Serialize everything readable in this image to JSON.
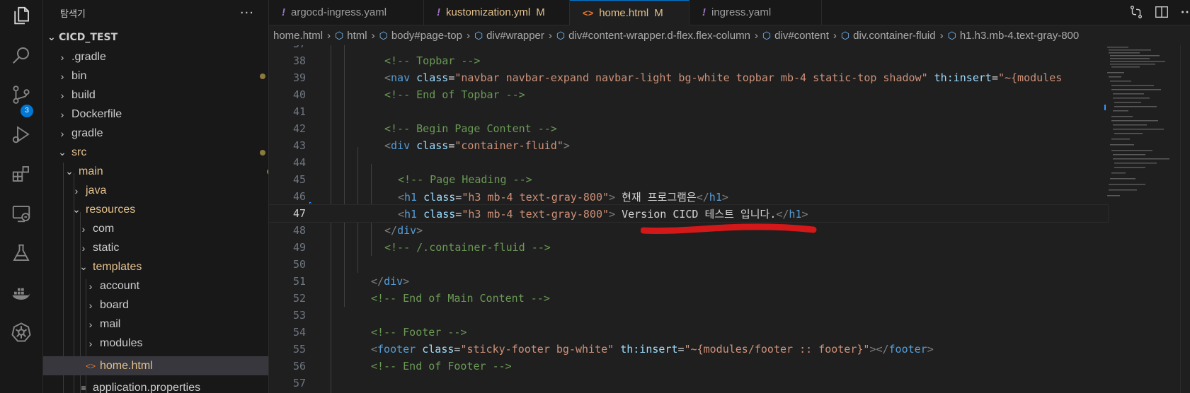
{
  "sidebar": {
    "title": "탐색기",
    "more": "···",
    "project": "CICD_TEST",
    "items": [
      {
        "label": ".gradle",
        "color": "#cccccc"
      },
      {
        "label": "bin",
        "color": "#cccccc"
      },
      {
        "label": "build",
        "color": "#cccccc"
      },
      {
        "label": "Dockerfile",
        "color": "#cccccc"
      },
      {
        "label": "gradle",
        "color": "#cccccc"
      },
      {
        "label": "src",
        "color": "#e2c08d"
      },
      {
        "label": "main",
        "color": "#e2c08d"
      },
      {
        "label": "java",
        "color": "#e2c08d"
      },
      {
        "label": "resources",
        "color": "#e2c08d"
      },
      {
        "label": "com",
        "color": "#cccccc"
      },
      {
        "label": "static",
        "color": "#cccccc"
      },
      {
        "label": "templates",
        "color": "#e2c08d"
      },
      {
        "label": "account",
        "color": "#cccccc"
      },
      {
        "label": "board",
        "color": "#cccccc"
      },
      {
        "label": "mail",
        "color": "#cccccc"
      },
      {
        "label": "modules",
        "color": "#cccccc"
      },
      {
        "label": "home.html",
        "color": "#e2c08d",
        "git": "M"
      },
      {
        "label": "application.properties",
        "color": "#cccccc"
      }
    ]
  },
  "activity": {
    "scm_badge": "3"
  },
  "tabs": [
    {
      "label": "argocd-ingress.yaml",
      "icon": "!",
      "modified": ""
    },
    {
      "label": "kustomization.yml",
      "icon": "!",
      "modified": "M"
    },
    {
      "label": "home.html",
      "icon": "<>",
      "modified": "M"
    },
    {
      "label": "ingress.yaml",
      "icon": "!",
      "modified": ""
    }
  ],
  "breadcrumb": [
    "home.html",
    "html",
    "body#page-top",
    "div#wrapper",
    "div#content-wrapper.d-flex.flex-column",
    "div#content",
    "div.container-fluid",
    "h1.h3.mb-4.text-gray-800"
  ],
  "editor": {
    "line_numbers": [
      "37",
      "38",
      "39",
      "40",
      "41",
      "42",
      "43",
      "44",
      "45",
      "46",
      "47",
      "48",
      "49",
      "50",
      "51",
      "52",
      "53",
      "54",
      "55",
      "56",
      "57"
    ],
    "lines": {
      "l38": "<!-- Topbar -->",
      "l39_tag": "nav",
      "l39_attr1": "class",
      "l39_val1": "\"navbar navbar-expand navbar-light bg-white topbar mb-4 static-top shadow\"",
      "l39_attr2": "th:insert",
      "l39_val2": "\"~{modules",
      "l40": "<!-- End of Topbar -->",
      "l42": "<!-- Begin Page Content -->",
      "l43_tag": "div",
      "l43_attr": "class",
      "l43_val": "\"container-fluid\"",
      "l45": "<!-- Page Heading -->",
      "l46_tag": "h1",
      "l46_attr": "class",
      "l46_val": "\"h3 mb-4 text-gray-800\"",
      "l46_text": " 현재 프로그램은",
      "l47_tag": "h1",
      "l47_attr": "class",
      "l47_val": "\"h3 mb-4 text-gray-800\"",
      "l47_text": " Version CICD 테스트 입니다.",
      "l48_tag": "div",
      "l49": "<!-- /.container-fluid -->",
      "l51_tag": "div",
      "l52": "<!-- End of Main Content -->",
      "l54": "<!-- Footer -->",
      "l55_tag": "footer",
      "l55_attr1": "class",
      "l55_val1": "\"sticky-footer bg-white\"",
      "l55_attr2": "th:insert",
      "l55_val2": "\"~{modules/footer :: footer}\"",
      "l56": "<!-- End of Footer -->"
    }
  },
  "colors": {
    "accent": "#0078d4",
    "modified": "#e2c08d",
    "annotation": "#d21818"
  }
}
